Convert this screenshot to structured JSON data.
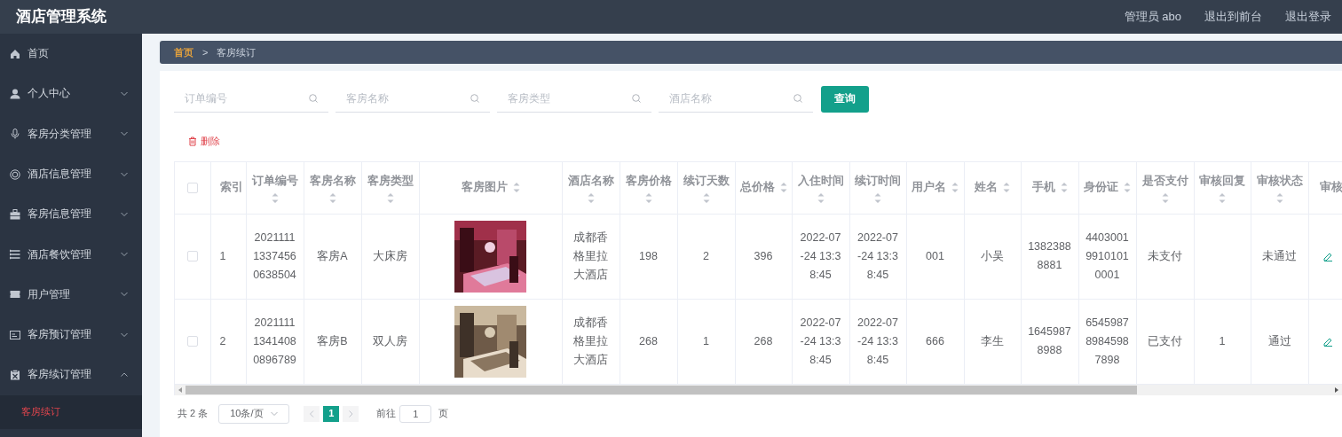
{
  "header": {
    "title": "酒店管理系统",
    "links": [
      "管理员 abo",
      "退出到前台",
      "退出登录"
    ]
  },
  "sidebar": {
    "items": [
      {
        "label": "首页",
        "expandable": false
      },
      {
        "label": "个人中心",
        "expandable": true,
        "expanded": false
      },
      {
        "label": "客房分类管理",
        "expandable": true,
        "expanded": false
      },
      {
        "label": "酒店信息管理",
        "expandable": true,
        "expanded": false
      },
      {
        "label": "客房信息管理",
        "expandable": true,
        "expanded": false
      },
      {
        "label": "酒店餐饮管理",
        "expandable": true,
        "expanded": false
      },
      {
        "label": "用户管理",
        "expandable": true,
        "expanded": false
      },
      {
        "label": "客房预订管理",
        "expandable": true,
        "expanded": false
      },
      {
        "label": "客房续订管理",
        "expandable": true,
        "expanded": true,
        "children": [
          {
            "label": "客房续订",
            "selected": true
          }
        ]
      }
    ]
  },
  "breadcrumb": {
    "items": [
      "首页",
      "客房续订"
    ],
    "separator": ">"
  },
  "search": {
    "fields": [
      {
        "placeholder": "订单编号"
      },
      {
        "placeholder": "客房名称"
      },
      {
        "placeholder": "客房类型"
      },
      {
        "placeholder": "酒店名称"
      }
    ],
    "button": "查询"
  },
  "delete_button": "删除",
  "table": {
    "header_checked": false,
    "columns": [
      {
        "kind": "text",
        "label": "索引",
        "sortable": false
      },
      {
        "kind": "text",
        "label": "订单编号",
        "sortable": true
      },
      {
        "kind": "text",
        "label": "客房名称",
        "sortable": true
      },
      {
        "kind": "text",
        "label": "客房类型",
        "sortable": true
      },
      {
        "kind": "picture",
        "label": "客房图片",
        "sortable": true
      },
      {
        "kind": "text",
        "label": "酒店名称",
        "sortable": true
      },
      {
        "kind": "text",
        "label": "客房价格",
        "sortable": true
      },
      {
        "kind": "text",
        "label": "续订天数",
        "sortable": true
      },
      {
        "kind": "text",
        "label": "总价格",
        "sortable": true
      },
      {
        "kind": "text",
        "label": "入住时间",
        "sortable": true
      },
      {
        "kind": "text",
        "label": "续订时间",
        "sortable": true
      },
      {
        "kind": "text",
        "label": "用户名",
        "sortable": true
      },
      {
        "kind": "text",
        "label": "姓名",
        "sortable": true
      },
      {
        "kind": "text",
        "label": "手机",
        "sortable": true
      },
      {
        "kind": "text",
        "label": "身份证",
        "sortable": true
      },
      {
        "kind": "text",
        "label": "是否支付",
        "sortable": true
      },
      {
        "kind": "text",
        "label": "审核回复",
        "sortable": true
      },
      {
        "kind": "text",
        "label": "审核状态",
        "sortable": true
      },
      {
        "kind": "actions",
        "label": "审核",
        "sortable": false
      }
    ],
    "rows": [
      {
        "checked": false,
        "cells": [
          "1",
          "202111113374560638504",
          "客房A",
          "大床房",
          null,
          "成都香格里拉大酒店",
          "198",
          "2",
          "396",
          "2022-07-24 13:38:45",
          "2022-07-24 13:38:45",
          "001",
          "小吴",
          "13823888881",
          "440300199101010001",
          "未支付",
          null,
          "未通过",
          null
        ]
      },
      {
        "checked": false,
        "cells": [
          "2",
          "202111113414080896789",
          "客房B",
          "双人房",
          null,
          "成都香格里拉大酒店",
          "268",
          "1",
          "268",
          "2022-07-24 13:38:45",
          "2022-07-24 13:38:45",
          "666",
          "李生",
          "16459878988",
          "654598789845987898",
          "已支付",
          "1",
          "通过",
          null
        ]
      }
    ]
  },
  "pagination": {
    "total": "共 2 条",
    "page_size": "10条/页",
    "pages": [
      {
        "label": "1",
        "selected": true
      }
    ],
    "goto_label": "前往",
    "goto_value": "1",
    "goto_suffix": "页"
  }
}
